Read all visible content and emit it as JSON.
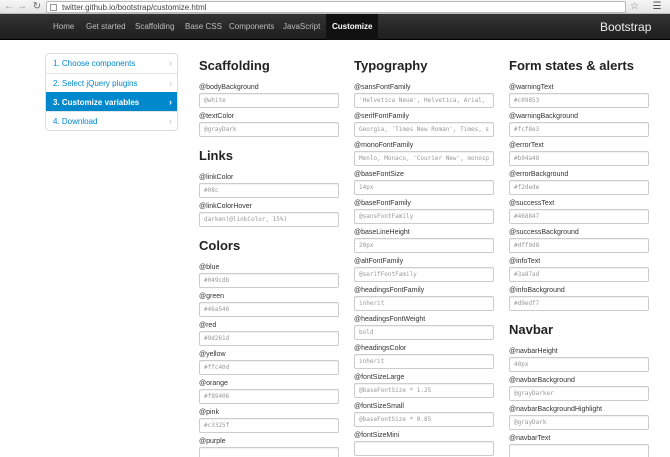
{
  "browser": {
    "url": "twitter.github.io/bootstrap/customize.html"
  },
  "navbar": {
    "links": [
      "Home",
      "Get started",
      "Scaffolding",
      "Base CSS",
      "Components",
      "JavaScript",
      "Customize"
    ],
    "brand": "Bootstrap"
  },
  "steps": [
    {
      "label": "1. Choose components"
    },
    {
      "label": "2. Select jQuery plugins"
    },
    {
      "label": "3. Customize variables"
    },
    {
      "label": "4. Download"
    }
  ],
  "col1": {
    "scaffolding": {
      "title": "Scaffolding",
      "vars": [
        {
          "name": "@bodyBackground",
          "placeholder": "@white"
        },
        {
          "name": "@textColor",
          "placeholder": "@grayDark"
        }
      ]
    },
    "links": {
      "title": "Links",
      "vars": [
        {
          "name": "@linkColor",
          "placeholder": "#08c"
        },
        {
          "name": "@linkColorHover",
          "placeholder": "darken(@linkColor, 15%)"
        }
      ]
    },
    "colors": {
      "title": "Colors",
      "vars": [
        {
          "name": "@blue",
          "placeholder": "#049cdb"
        },
        {
          "name": "@green",
          "placeholder": "#46a546"
        },
        {
          "name": "@red",
          "placeholder": "#9d261d"
        },
        {
          "name": "@yellow",
          "placeholder": "#ffc40d"
        },
        {
          "name": "@orange",
          "placeholder": "#f89406"
        },
        {
          "name": "@pink",
          "placeholder": "#c3325f"
        },
        {
          "name": "@purple",
          "placeholder": ""
        }
      ]
    }
  },
  "col2": {
    "typography": {
      "title": "Typography",
      "vars": [
        {
          "name": "@sansFontFamily",
          "placeholder": "'Helvetica Neue', Helvetica, Arial, sa"
        },
        {
          "name": "@serifFontFamily",
          "placeholder": "Georgia, 'Times New Roman', Times, se"
        },
        {
          "name": "@monoFontFamily",
          "placeholder": "Menlo, Monaco, 'Courier New', monospa"
        },
        {
          "name": "@baseFontSize",
          "placeholder": "14px"
        },
        {
          "name": "@baseFontFamily",
          "placeholder": "@sansFontFamily"
        },
        {
          "name": "@baseLineHeight",
          "placeholder": "20px"
        },
        {
          "name": "@altFontFamily",
          "placeholder": "@serifFontFamily"
        },
        {
          "name": "@headingsFontFamily",
          "placeholder": "inherit"
        },
        {
          "name": "@headingsFontWeight",
          "placeholder": "bold"
        },
        {
          "name": "@headingsColor",
          "placeholder": "inherit"
        },
        {
          "name": "@fontSizeLarge",
          "placeholder": "@baseFontSize * 1.25"
        },
        {
          "name": "@fontSizeSmall",
          "placeholder": "@baseFontSize * 0.85"
        },
        {
          "name": "@fontSizeMini",
          "placeholder": ""
        }
      ]
    }
  },
  "col3": {
    "alerts": {
      "title": "Form states & alerts",
      "vars": [
        {
          "name": "@warningText",
          "placeholder": "#c09853"
        },
        {
          "name": "@warningBackground",
          "placeholder": "#fcf8e3"
        },
        {
          "name": "@errorText",
          "placeholder": "#b94a48"
        },
        {
          "name": "@errorBackground",
          "placeholder": "#f2dede"
        },
        {
          "name": "@successText",
          "placeholder": "#468847"
        },
        {
          "name": "@successBackground",
          "placeholder": "#dff0d8"
        },
        {
          "name": "@infoText",
          "placeholder": "#3a87ad"
        },
        {
          "name": "@infoBackground",
          "placeholder": "#d9edf7"
        }
      ]
    },
    "navbar": {
      "title": "Navbar",
      "vars": [
        {
          "name": "@navbarHeight",
          "placeholder": "40px"
        },
        {
          "name": "@navbarBackground",
          "placeholder": "@grayDarker"
        },
        {
          "name": "@navbarBackgroundHighlight",
          "placeholder": "@grayDark"
        },
        {
          "name": "@navbarText",
          "placeholder": ""
        }
      ]
    }
  },
  "colors": {
    "accent": "#0088cc",
    "navbar_bg": "#222222"
  }
}
